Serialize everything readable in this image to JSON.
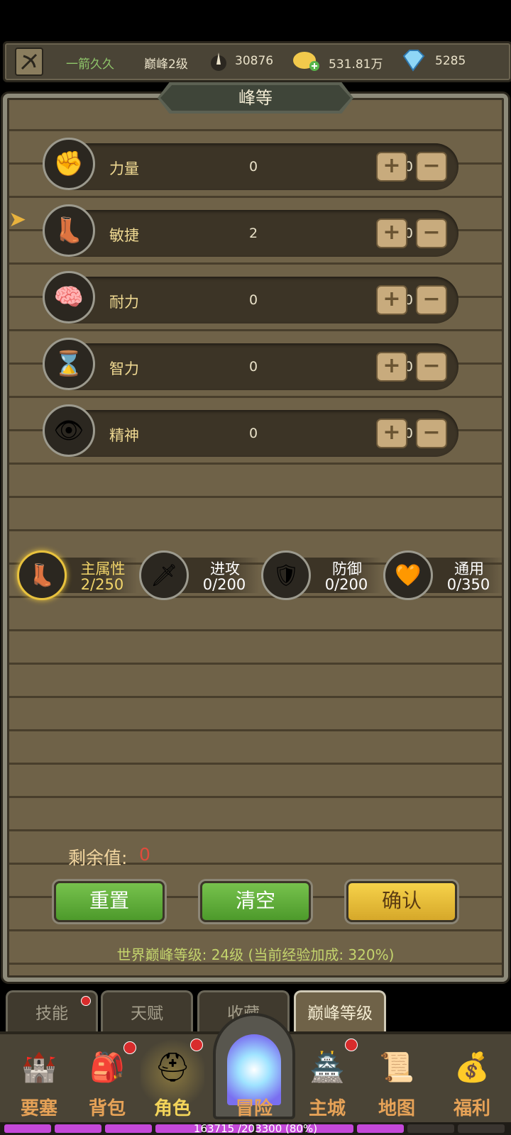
{
  "topbar": {
    "player_name": "一箭久久",
    "peak_level": "巅峰2级",
    "swords": "30876",
    "gold": "531.81万",
    "diamonds": "5285"
  },
  "panel": {
    "title": "峰等"
  },
  "attributes": [
    {
      "name": "力量",
      "value": "0",
      "max": "0/50",
      "icon": "fist-icon"
    },
    {
      "name": "敏捷",
      "value": "2",
      "max": "2/50",
      "icon": "boot-icon"
    },
    {
      "name": "耐力",
      "value": "0",
      "max": "0/50",
      "icon": "brain-icon"
    },
    {
      "name": "智力",
      "value": "0",
      "max": "0/50",
      "icon": "hourglass-icon"
    },
    {
      "name": "精神",
      "value": "0",
      "max": "0/50",
      "icon": "eye-icon"
    }
  ],
  "categories": [
    {
      "name": "主属性",
      "value": "2/250",
      "icon": "boot-icon"
    },
    {
      "name": "进攻",
      "value": "0/200",
      "icon": "sword-icon"
    },
    {
      "name": "防御",
      "value": "0/200",
      "icon": "shield-icon"
    },
    {
      "name": "通用",
      "value": "0/350",
      "icon": "heart-icon"
    }
  ],
  "remaining": {
    "label": "剩余值:",
    "value": "0"
  },
  "buttons": {
    "reset": "重置",
    "clear": "清空",
    "confirm": "确认"
  },
  "world_info": "世界巅峰等级: 24级 (当前经验加成: 320%)",
  "subtabs": [
    "技能",
    "天赋",
    "收藏",
    "巅峰等级"
  ],
  "nav": [
    "要塞",
    "背包",
    "角色",
    "冒险",
    "主城",
    "地图",
    "福利"
  ],
  "exp": {
    "text": "163715 /203300 (80%)",
    "progress": 0.8
  },
  "colors": {
    "accent": "#f2d56a",
    "green": "#5bab37",
    "yellow": "#e8be38",
    "red": "#e04b3c"
  }
}
